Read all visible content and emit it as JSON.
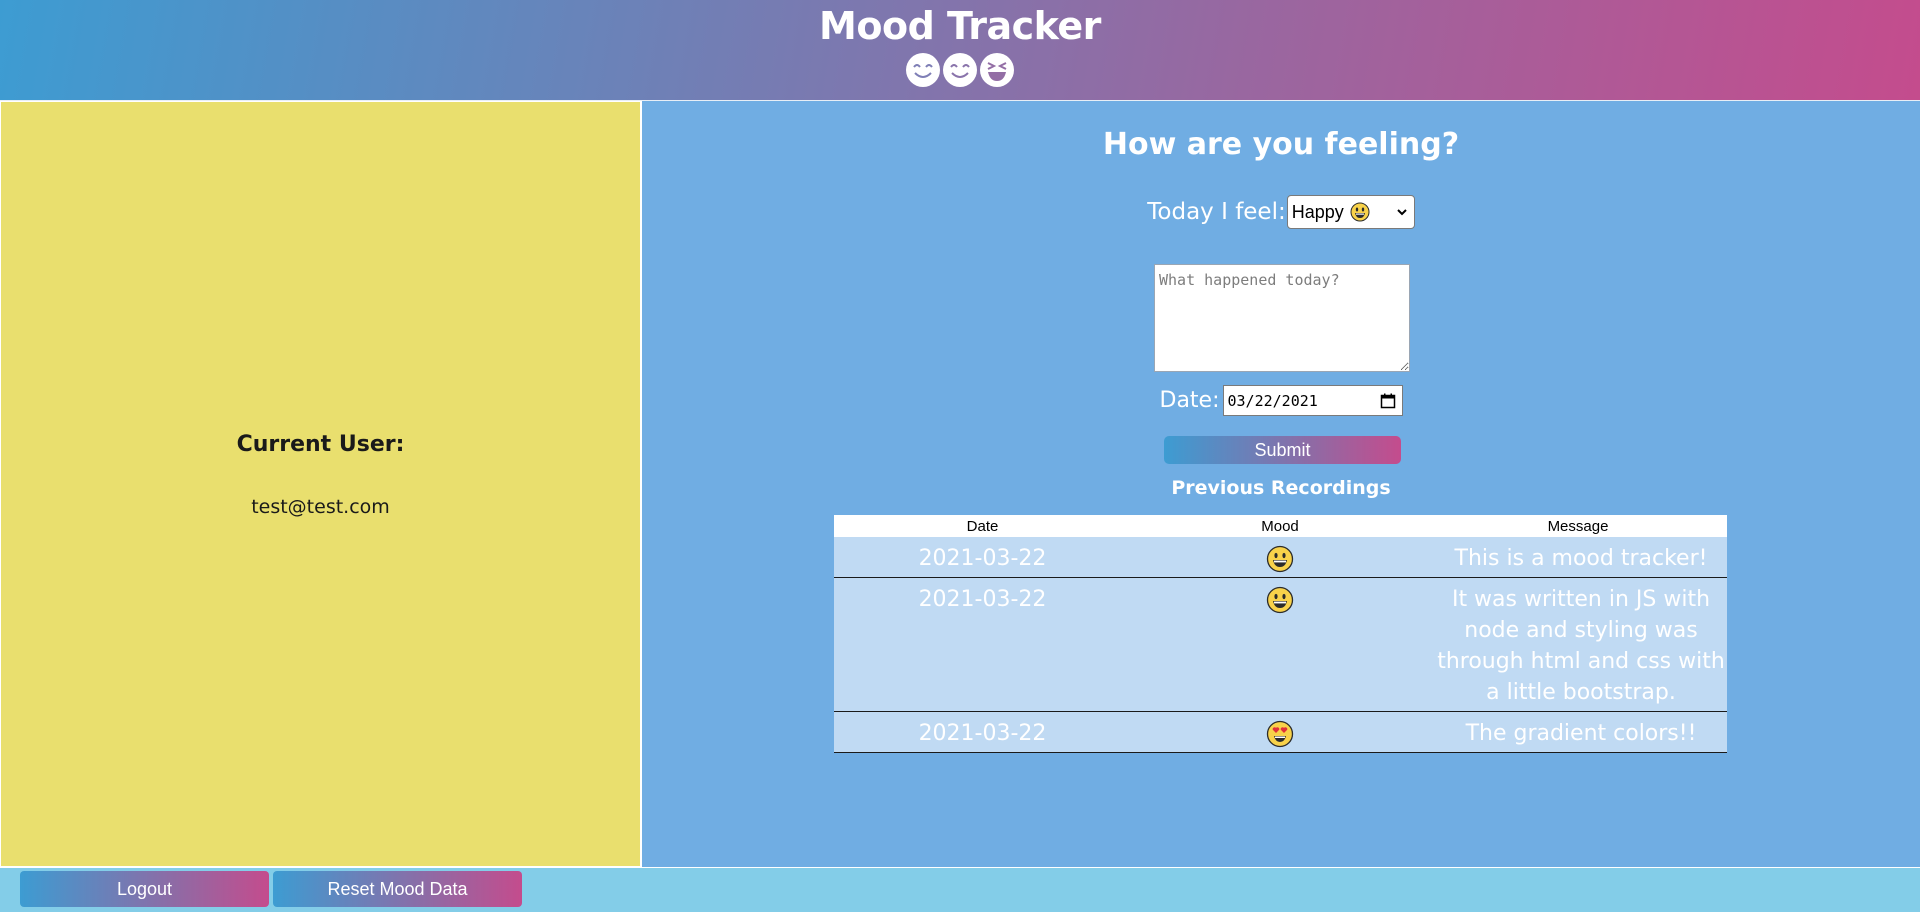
{
  "header": {
    "title": "Mood Tracker",
    "icons": [
      "smiling-face-icon",
      "smiling-face-icon",
      "laughing-face-icon"
    ]
  },
  "sidebar": {
    "current_user_label": "Current User:",
    "current_user_email": "test@test.com"
  },
  "form": {
    "heading": "How are you feeling?",
    "feel_label": "Today I feel:",
    "mood_select": {
      "selected": "Happy",
      "selected_icon": "grinning-face-icon"
    },
    "notes_placeholder": "What happened today?",
    "date_label": "Date:",
    "date_value": "03/22/2021",
    "submit_label": "Submit"
  },
  "recordings": {
    "heading": "Previous Recordings",
    "columns": [
      "Date",
      "Mood",
      "Message"
    ],
    "rows": [
      {
        "date": "2021-03-22",
        "mood_icon": "grinning-face-icon",
        "message": "This is a mood tracker!"
      },
      {
        "date": "2021-03-22",
        "mood_icon": "grinning-face-icon",
        "message": "It was written in JS with node and styling was through html and css with a little bootstrap."
      },
      {
        "date": "2021-03-22",
        "mood_icon": "heart-eyes-face-icon",
        "message": "The gradient colors!!"
      }
    ]
  },
  "footer": {
    "logout_label": "Logout",
    "reset_label": "Reset Mood Data"
  },
  "colors": {
    "header_gradient_start": "#3d9cd2",
    "header_gradient_end": "#c44c8d",
    "sidebar_bg": "#e9df6e",
    "main_bg": "#70ade3",
    "table_row_bg": "#c0daf3",
    "footer_bg": "#83cde8"
  }
}
